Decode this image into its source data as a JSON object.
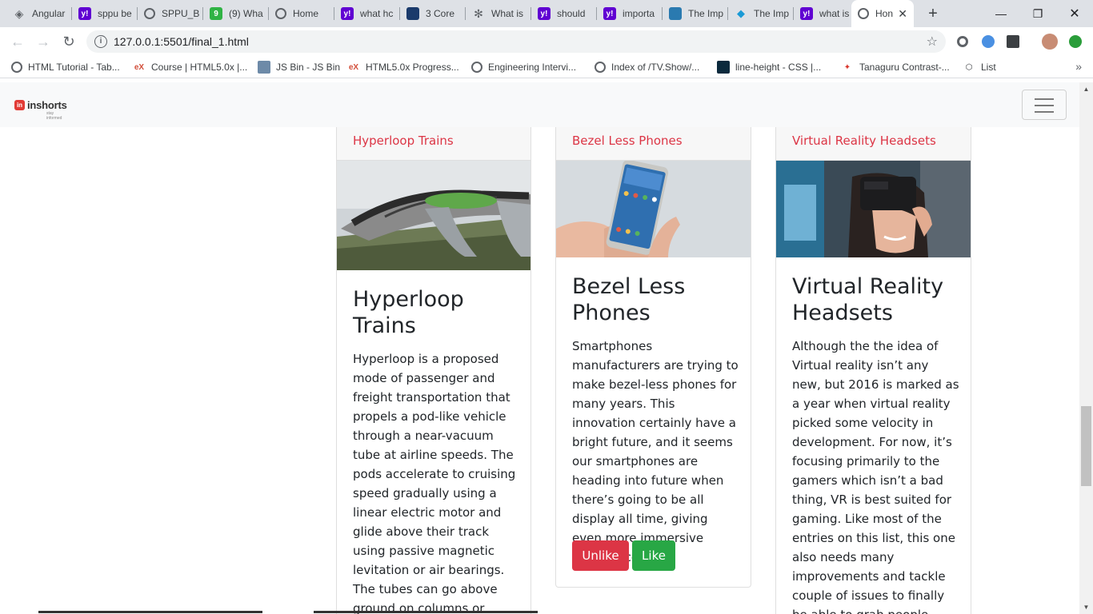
{
  "browser": {
    "tabs": [
      {
        "title": "Angular",
        "icon": "angular-icon",
        "color": "#5f6368"
      },
      {
        "title": "sppu be",
        "icon": "yahoo-icon",
        "color": "#6001d2"
      },
      {
        "title": "SPPU_B",
        "icon": "globe-icon",
        "color": "#5f6368"
      },
      {
        "title": "(9) Wha",
        "icon": "quora-icon",
        "color": "#2fb344"
      },
      {
        "title": "Home",
        "icon": "globe-icon",
        "color": "#5f6368"
      },
      {
        "title": "what hc",
        "icon": "yahoo-icon",
        "color": "#6001d2"
      },
      {
        "title": "3 Core",
        "icon": "site-icon",
        "color": "#1a3a6b"
      },
      {
        "title": "What is",
        "icon": "brain-icon",
        "color": "#5f6368"
      },
      {
        "title": "should",
        "icon": "yahoo-icon",
        "color": "#6001d2"
      },
      {
        "title": "importa",
        "icon": "yahoo-icon",
        "color": "#6001d2"
      },
      {
        "title": "The Imp",
        "icon": "site-icon",
        "color": "#2a7ab0"
      },
      {
        "title": "The Imp",
        "icon": "diamond-icon",
        "color": "#1a9ad6"
      },
      {
        "title": "what is",
        "icon": "yahoo-icon",
        "color": "#6001d2"
      },
      {
        "title": "Hon",
        "icon": "globe-icon",
        "color": "#5f6368"
      }
    ],
    "close_glyph": "✕",
    "new_tab_glyph": "+",
    "url": "127.0.0.1:5501/final_1.html",
    "bookmarks": [
      {
        "label": "HTML Tutorial - Tab...",
        "icon": "globe-icon"
      },
      {
        "label": "Course | HTML5.0x |...",
        "icon": "edx-icon"
      },
      {
        "label": "JS Bin - JS Bin",
        "icon": "jsbin-icon"
      },
      {
        "label": "HTML5.0x Progress...",
        "icon": "edx-icon"
      },
      {
        "label": "Engineering Intervi...",
        "icon": "globe-icon"
      },
      {
        "label": "Index of /TV.Show/...",
        "icon": "globe-icon"
      },
      {
        "label": "line-height - CSS |...",
        "icon": "mdn-icon"
      },
      {
        "label": "Tanaguru Contrast-...",
        "icon": "tanaguru-icon"
      },
      {
        "label": "List",
        "icon": "codepen-icon"
      }
    ]
  },
  "page": {
    "brand": "inshorts",
    "brand_tagline": "stay informed",
    "cards": [
      {
        "header": "Hyperloop Trains",
        "title": "Hyperloop Trains",
        "text": "Hyperloop is a proposed mode of passenger and freight transportation that propels a pod-like vehicle through a near-vacuum tube at airline speeds. The pods accelerate to cruising speed gradually using a linear electric motor and glide above their track using passive magnetic levitation or air bearings. The tubes can go above ground on columns or underground,"
      },
      {
        "header": "Bezel Less Phones",
        "title": "Bezel Less Phones",
        "text": "Smartphones manufacturers are trying to make bezel-less phones for many years. This innovation certainly have a bright future, and it seems our smartphones are heading into future when there’s going to be all display all time, giving even more immersive experience.",
        "unlike_label": "Unlike",
        "like_label": "Like"
      },
      {
        "header": "Virtual Reality Headsets",
        "title": "Virtual Reality Headsets",
        "text": "Although the the idea of Virtual reality isn’t any new, but 2016 is marked as a year when virtual reality picked some velocity in development. For now, it’s focusing primarily to the gamers which isn’t a bad thing, VR is best suited for gaming. Like most of the entries on this list, this one also needs many improvements and tackle couple of issues to finally be able to grab people"
      }
    ]
  }
}
